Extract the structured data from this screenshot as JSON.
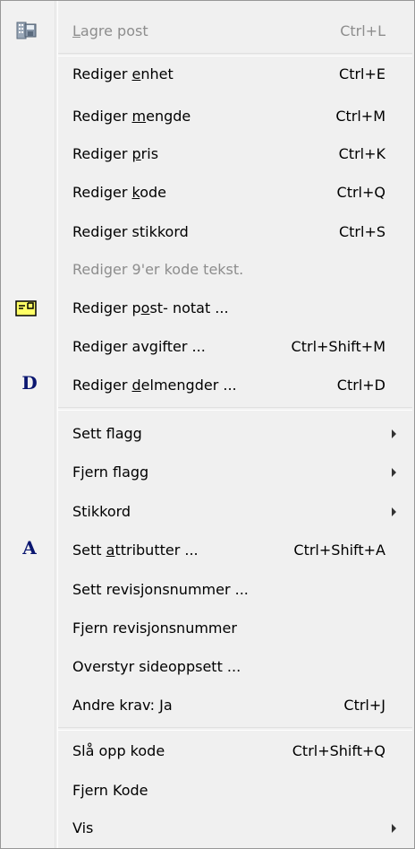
{
  "menu": {
    "lagre_post": {
      "label_pre": "",
      "label_mnemonic": "L",
      "label_post": "agre post",
      "shortcut": "Ctrl+L"
    },
    "rediger_enhet": {
      "label_pre": "Rediger ",
      "label_mnemonic": "e",
      "label_post": "nhet",
      "shortcut": "Ctrl+E"
    },
    "rediger_mengde": {
      "label_pre": "Rediger ",
      "label_mnemonic": "m",
      "label_post": "engde",
      "shortcut": "Ctrl+M"
    },
    "rediger_pris": {
      "label_pre": "Rediger ",
      "label_mnemonic": "p",
      "label_post": "ris",
      "shortcut": "Ctrl+K"
    },
    "rediger_kode": {
      "label_pre": "Rediger ",
      "label_mnemonic": "k",
      "label_post": "ode",
      "shortcut": "Ctrl+Q"
    },
    "rediger_stikkord": {
      "label": "Rediger stikkord",
      "shortcut": "Ctrl+S"
    },
    "rediger_9er": {
      "label": "Rediger 9'er kode tekst."
    },
    "rediger_post_notat": {
      "label_pre": "Rediger p",
      "label_mnemonic": "o",
      "label_post": "st- notat ..."
    },
    "rediger_avgifter": {
      "label": "Rediger avgifter ...",
      "shortcut": "Ctrl+Shift+M"
    },
    "rediger_delmengder": {
      "label_pre": "Rediger ",
      "label_mnemonic": "d",
      "label_post": "elmengder ...",
      "shortcut": "Ctrl+D",
      "icon_letter": "D"
    },
    "sett_flagg": {
      "label": "Sett flagg"
    },
    "fjern_flagg": {
      "label": "Fjern flagg"
    },
    "stikkord": {
      "label": "Stikkord"
    },
    "sett_attributter": {
      "label_pre": "Sett ",
      "label_mnemonic": "a",
      "label_post": "ttributter ...",
      "shortcut": "Ctrl+Shift+A",
      "icon_letter": "A"
    },
    "sett_revisjonsnummer": {
      "label": "Sett revisjonsnummer ..."
    },
    "fjern_revisjonsnummer": {
      "label": "Fjern revisjonsnummer"
    },
    "overstyr_sideoppsett": {
      "label": "Overstyr sideoppsett ..."
    },
    "andre_krav": {
      "label": "Andre krav: Ja",
      "shortcut": "Ctrl+J"
    },
    "sla_opp_kode": {
      "label": "Slå opp kode",
      "shortcut": "Ctrl+Shift+Q"
    },
    "fjern_kode": {
      "label": "Fjern Kode"
    },
    "vis": {
      "label": "Vis"
    }
  },
  "icons": {
    "save": "save-post-icon",
    "note": "post-note-icon",
    "delmengder": "letter-d-icon",
    "attributter": "letter-a-icon"
  },
  "colors": {
    "menu_bg": "#f0f0f0",
    "disabled_text": "#8d8d8d",
    "icon_letter": "#0a1670",
    "note_yellow": "#ffff66"
  }
}
